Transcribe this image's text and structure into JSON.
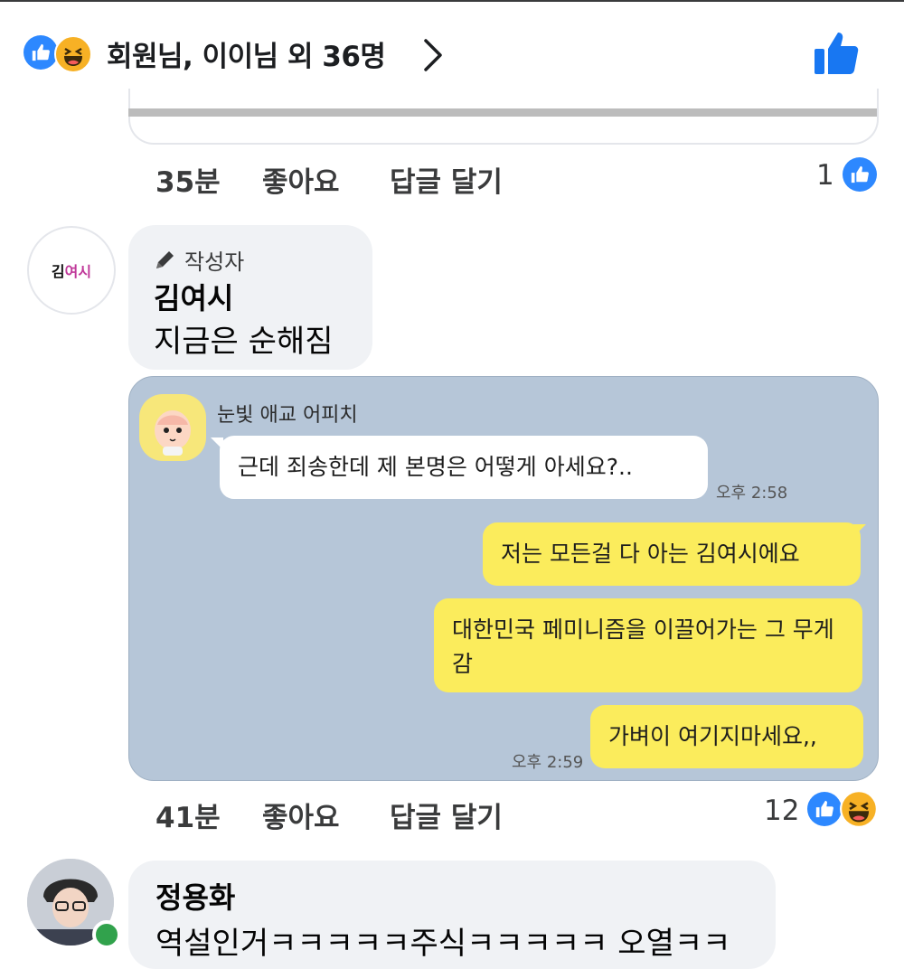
{
  "reactions_summary": {
    "text": "회원님, 이이님 외 36명",
    "icons": [
      "like-icon",
      "haha-icon"
    ],
    "colors": {
      "like": "#2d88ff",
      "haha": "#f7b125"
    }
  },
  "comment_prev": {
    "time": "35분",
    "like_label": "좋아요",
    "reply_label": "답글 달기",
    "reaction_count": "1"
  },
  "comment_author": {
    "avatar_text_a": "김",
    "avatar_text_b": "여시",
    "badge": "작성자",
    "name": "김여시",
    "text": "지금은 순해짐",
    "time": "41분",
    "like_label": "좋아요",
    "reply_label": "답글 달기",
    "reaction_count": "12"
  },
  "kakao_image": {
    "sender_name": "눈빛 애교 어피치",
    "incoming_message": "근데 죄송한데 제 본명은 어떻게 아세요?..",
    "incoming_time": "오후 2:58",
    "outgoing_messages": [
      "저는 모든걸 다 아는 김여시에요",
      "대한민국 페미니즘을 이끌어가는 그 무게감",
      "가벼이 여기지마세요,,"
    ],
    "outgoing_time": "오후 2:59",
    "colors": {
      "background": "#b6c6d8",
      "outgoing_bubble": "#fbec5c"
    }
  },
  "comment_next": {
    "name": "정용화",
    "text": "역설인거ㅋㅋㅋㅋㅋ주식ㅋㅋㅋㅋㅋ 오열ㅋㅋ"
  }
}
